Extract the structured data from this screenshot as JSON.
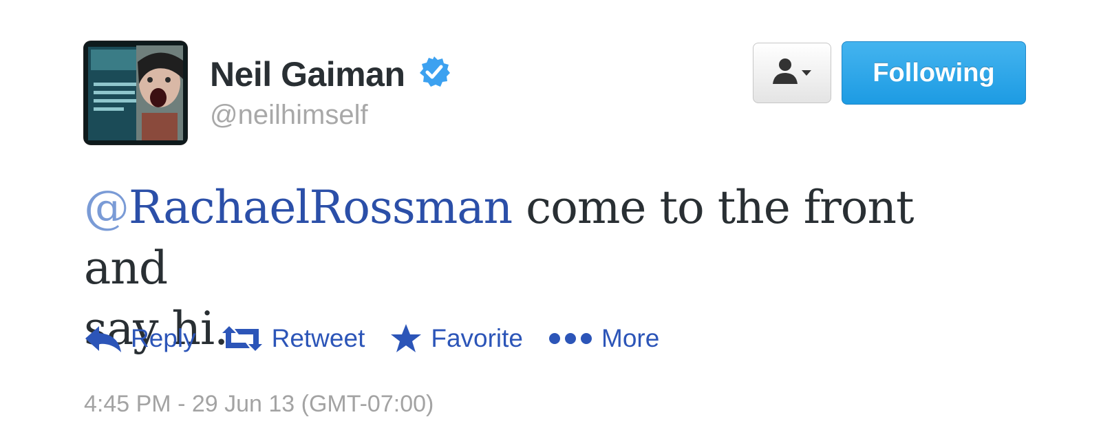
{
  "user": {
    "display_name": "Neil Gaiman",
    "handle": "@neilhimself",
    "avatar_icon": "book-cover-avatar",
    "verified_icon": "verified-badge-icon"
  },
  "header_buttons": {
    "user_actions_icon": "person-dropdown-icon",
    "follow_label": "Following"
  },
  "tweet": {
    "mention_at": "@",
    "mention_name": "RachaelRossman",
    "text_line1": " come to the front and",
    "text_line2": "say hi."
  },
  "actions": [
    {
      "label": "Reply",
      "icon": "reply-icon"
    },
    {
      "label": "Retweet",
      "icon": "retweet-icon"
    },
    {
      "label": "Favorite",
      "icon": "star-icon"
    },
    {
      "label": "More",
      "icon": "more-dots-icon"
    }
  ],
  "timestamp": "4:45 PM - 29 Jun 13 (GMT-07:00)",
  "colors": {
    "link": "#2c55b8",
    "follow_button": "#1d9be3",
    "verified": "#3ca1f0"
  }
}
